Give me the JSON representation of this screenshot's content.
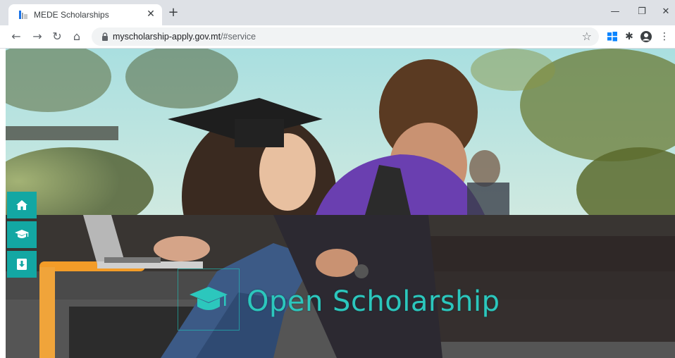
{
  "browser": {
    "tab": {
      "title": "MEDE Scholarships",
      "close_glyph": "✕"
    },
    "new_tab_glyph": "+",
    "window_controls": {
      "minimize": "—",
      "restore": "❐",
      "close": "✕"
    },
    "nav": {
      "back": "←",
      "forward": "→",
      "reload": "↻",
      "home": "⌂"
    },
    "address": {
      "host": "myscholarship-apply.gov.mt",
      "path": "/#service"
    },
    "bookmark_glyph": "☆",
    "extensions": {
      "puzzle": "✱",
      "menu": "⋮"
    }
  },
  "page": {
    "title": "Open Scholarship",
    "side_nav": [
      {
        "icon": "home-icon"
      },
      {
        "icon": "graduation-cap-icon"
      },
      {
        "icon": "document-download-icon"
      }
    ],
    "colors": {
      "accent": "#13a7a3",
      "title": "#2cc7bd"
    }
  }
}
